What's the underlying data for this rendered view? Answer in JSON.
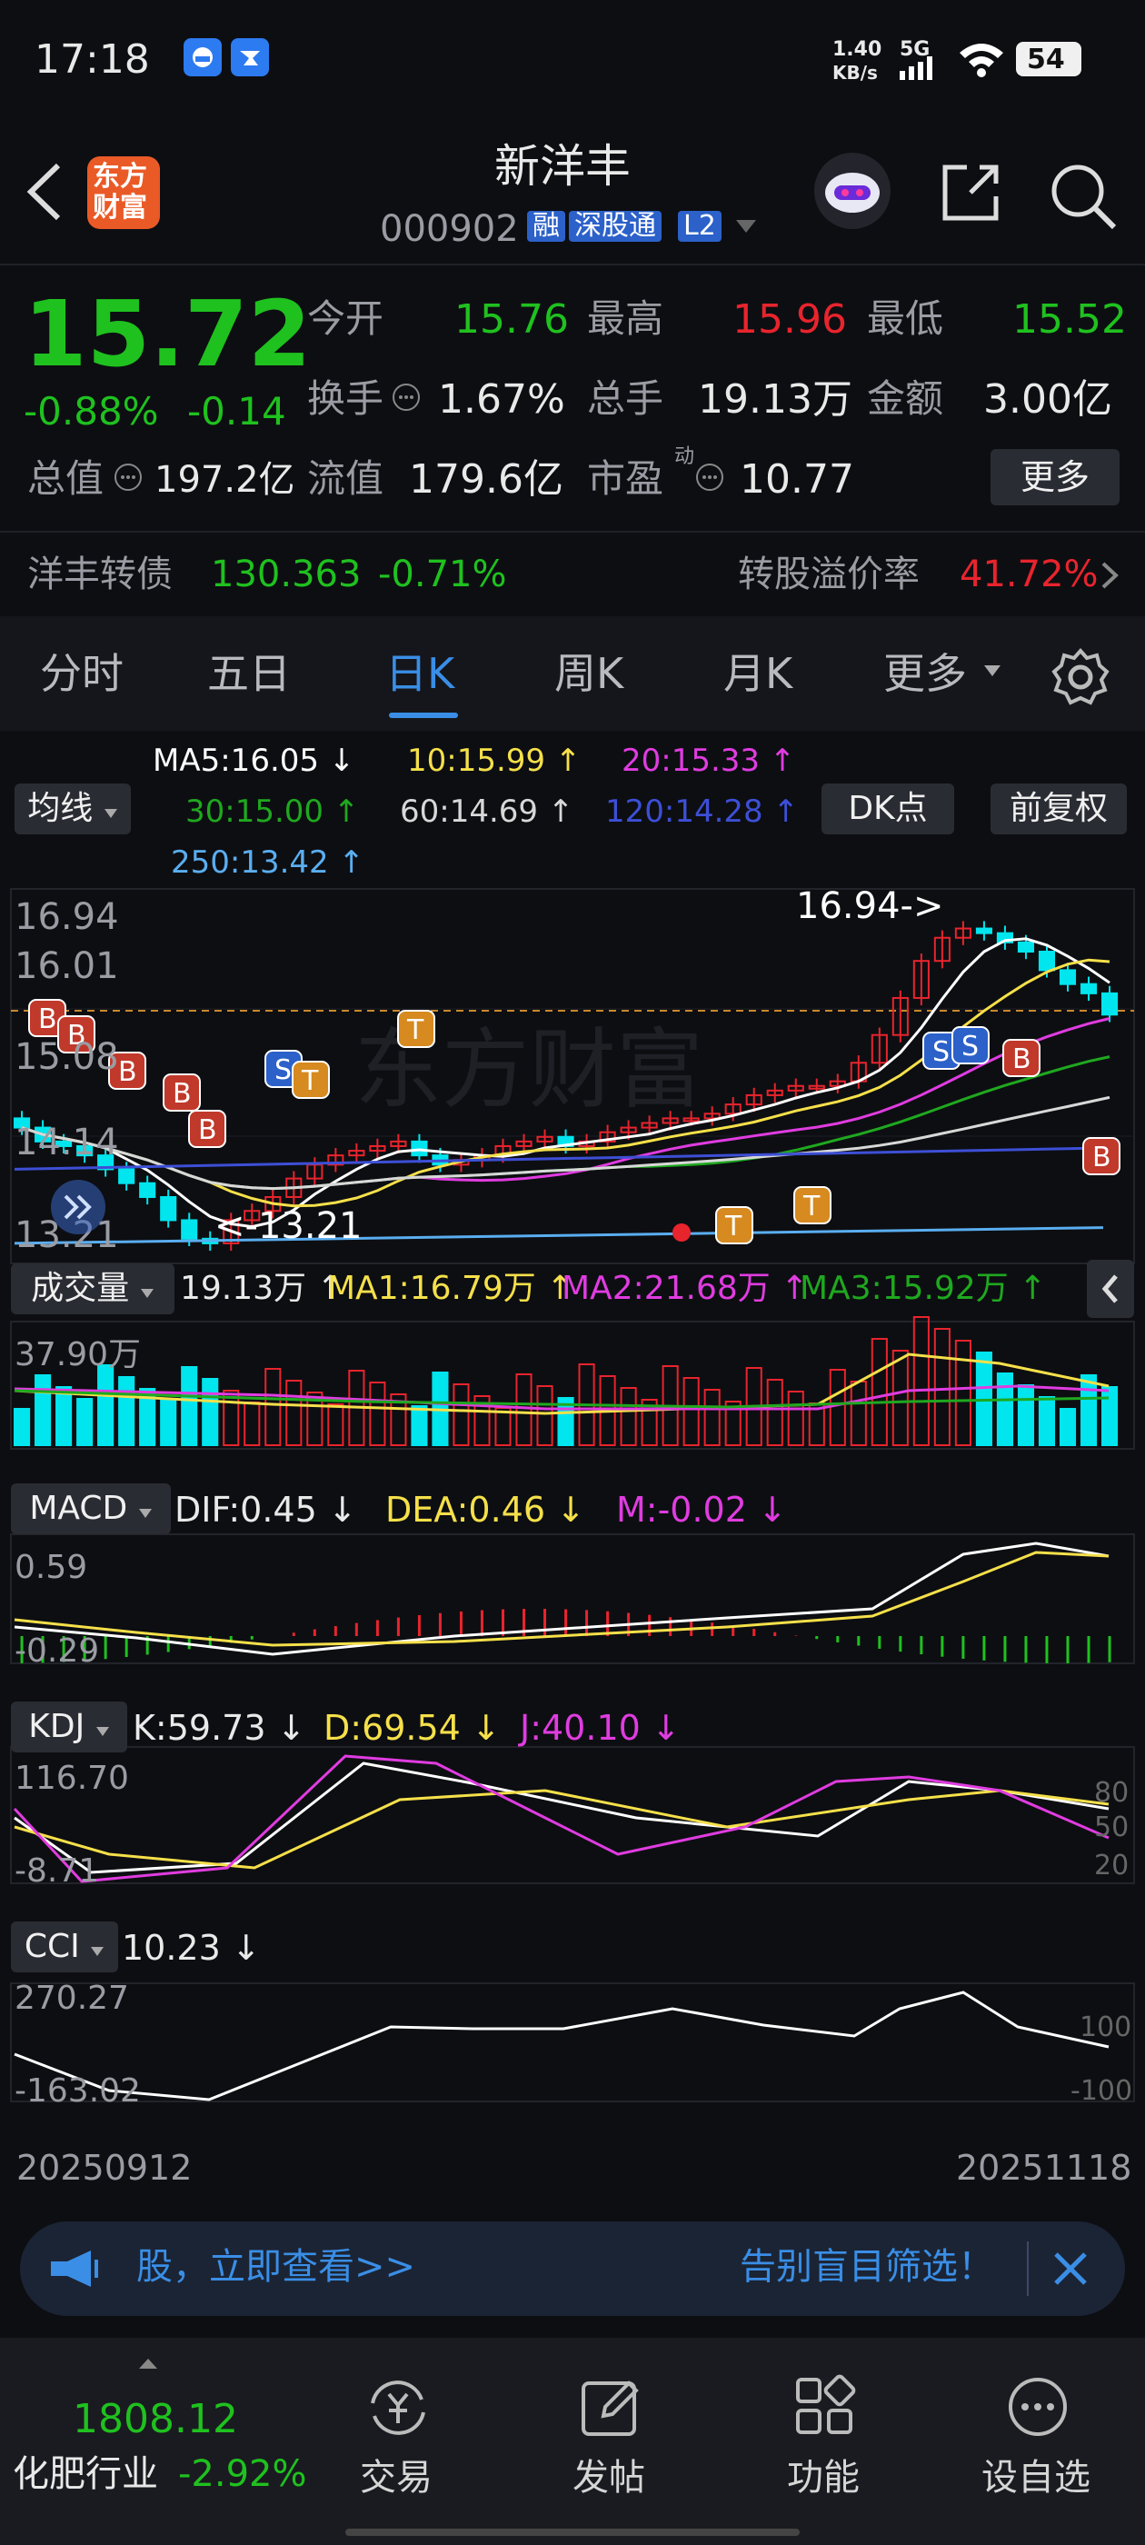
{
  "status_bar": {
    "time": "17:18",
    "net_speed_top": "1.40",
    "net_speed_bottom": "KB/s",
    "network": "5G",
    "battery": "54"
  },
  "header": {
    "app_logo_line1": "东方",
    "app_logo_line2": "财富",
    "stock_name": "新洋丰",
    "stock_code": "000902",
    "tags": [
      "融",
      "深股通",
      "L2"
    ]
  },
  "quote": {
    "price": "15.72",
    "change_pct": "-0.88%",
    "change_amt": "-0.14",
    "open_label": "今开",
    "open": "15.76",
    "high_label": "最高",
    "high": "15.96",
    "low_label": "最低",
    "low": "15.52",
    "turnover_label": "换手",
    "turnover": "1.67%",
    "volume_label": "总手",
    "volume": "19.13万",
    "amount_label": "金额",
    "amount": "3.00亿",
    "mktcap_label": "总值",
    "mktcap": "197.2亿",
    "float_label": "流值",
    "float": "179.6亿",
    "pe_label": "市盈",
    "pe_sup": "动",
    "pe": "10.77",
    "more_button": "更多"
  },
  "bond": {
    "name": "洋丰转债",
    "price": "130.363",
    "change": "-0.71%",
    "premium_label": "转股溢价率",
    "premium": "41.72%"
  },
  "tabs": [
    "分时",
    "五日",
    "日K",
    "周K",
    "月K",
    "更多"
  ],
  "active_tab": "日K",
  "ma_legend": {
    "selector": "均线",
    "ma5": "MA5:16.05 ↓",
    "ma10": "10:15.99 ↑",
    "ma20": "20:15.33 ↑",
    "ma30": "30:15.00 ↑",
    "ma60": "60:14.69 ↑",
    "ma120": "120:14.28 ↑",
    "ma250": "250:13.42 ↑",
    "dk_button": "DK点",
    "adjust_button": "前复权"
  },
  "kline_axis": {
    "top": "16.94",
    "second": "16.01",
    "third": "15.08",
    "fourth": "14.14",
    "bottom": "13.21",
    "max_marker": "16.94->",
    "min_marker": "<-13.21",
    "watermark": "东方财富"
  },
  "signals": {
    "b": "B",
    "s": "S",
    "t": "T"
  },
  "volume_panel": {
    "selector": "成交量",
    "vol": "19.13万 ↑",
    "ma1": "MA1:16.79万 ↑",
    "ma2": "MA2:21.68万 ↑",
    "ma3": "MA3:15.92万 ↑",
    "axis_top": "37.90万"
  },
  "macd_panel": {
    "selector": "MACD",
    "dif": "DIF:0.45 ↓",
    "dea": "DEA:0.46 ↓",
    "m": "M:-0.02 ↓",
    "axis_top": "0.59",
    "axis_bottom": "-0.29"
  },
  "kdj_panel": {
    "selector": "KDJ",
    "k": "K:59.73 ↓",
    "d": "D:69.54 ↓",
    "j": "J:40.10 ↓",
    "axis_top": "116.70",
    "axis_bottom": "-8.71",
    "ref_80": "80",
    "ref_50": "50",
    "ref_20": "20"
  },
  "cci_panel": {
    "selector": "CCI",
    "value": "10.23 ↓",
    "axis_top": "270.27",
    "axis_bottom": "-163.02",
    "ref_100": "100",
    "ref_m100": "-100"
  },
  "dates": {
    "start": "20250912",
    "end": "20251118"
  },
  "banner": {
    "text_left": "股，立即查看>>",
    "text_right": "告别盲目筛选！"
  },
  "bottom_nav": {
    "index_value": "1808.12",
    "index_name": "化肥行业",
    "index_change": "-2.92%",
    "items": [
      "交易",
      "发帖",
      "功能",
      "设自选"
    ]
  },
  "colors": {
    "up": "#e8242d",
    "down": "#1fc11f",
    "down_candle": "#00e5ee",
    "ma5": "#ffffff",
    "ma10": "#f5e04a",
    "ma20": "#e03ce0",
    "ma30": "#1fa81f",
    "ma60": "#d8d8d8",
    "ma120": "#3d4fd6",
    "ma250": "#5aaef0",
    "accent": "#3a8ee6"
  }
}
